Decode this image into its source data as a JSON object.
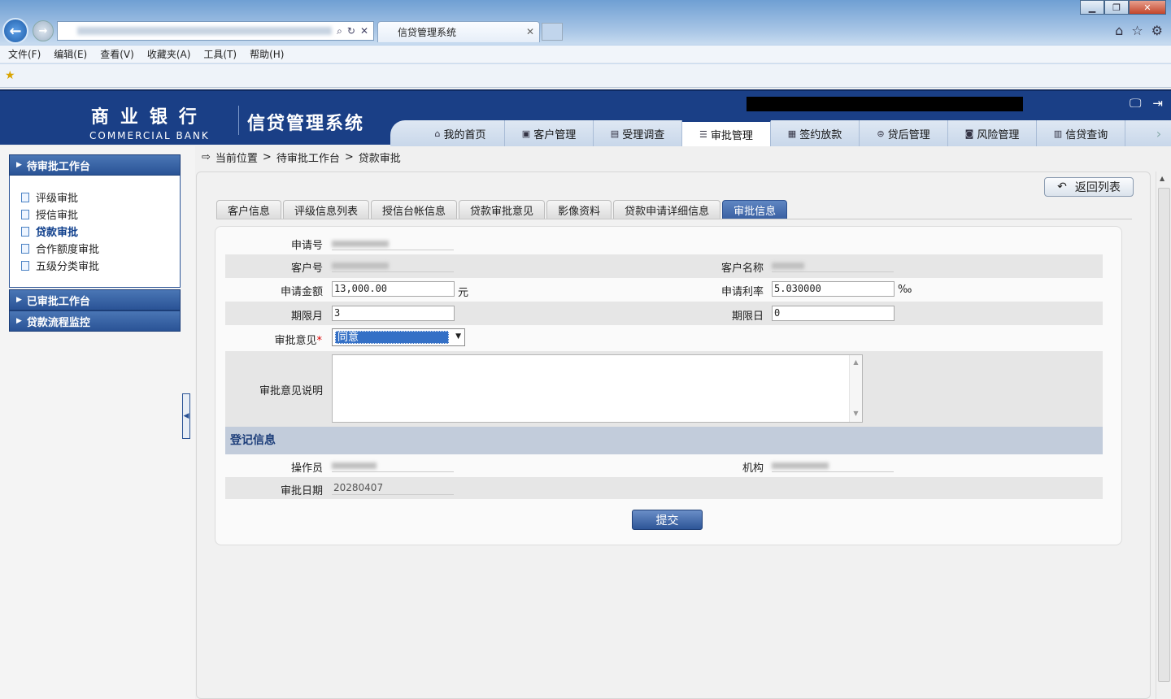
{
  "browser": {
    "tab_title": "信贷管理系统",
    "menu": [
      "文件(F)",
      "编辑(E)",
      "查看(V)",
      "收藏夹(A)",
      "工具(T)",
      "帮助(H)"
    ]
  },
  "header": {
    "bank_cn": "商业银行",
    "bank_en": "COMMERCIAL BANK",
    "system_name": "信贷管理系统",
    "nav": [
      {
        "label": "我的首页",
        "icon": "home-icon"
      },
      {
        "label": "客户管理",
        "icon": "customer-icon"
      },
      {
        "label": "受理调查",
        "icon": "survey-icon"
      },
      {
        "label": "审批管理",
        "icon": "approval-icon",
        "active": true
      },
      {
        "label": "签约放款",
        "icon": "contract-icon"
      },
      {
        "label": "贷后管理",
        "icon": "postloan-icon"
      },
      {
        "label": "风险管理",
        "icon": "risk-icon"
      },
      {
        "label": "信贷查询",
        "icon": "query-icon"
      }
    ]
  },
  "sidebar": {
    "pending_title": "待审批工作台",
    "items": [
      "评级审批",
      "授信审批",
      "贷款审批",
      "合作额度审批",
      "五级分类审批"
    ],
    "selected_index": 2,
    "approved_title": "已审批工作台",
    "monitor_title": "贷款流程监控"
  },
  "breadcrumb": {
    "current": "当前位置",
    "sep": ">",
    "level1": "待审批工作台",
    "level2": "贷款审批"
  },
  "return_label": "返回列表",
  "tabs": [
    "客户信息",
    "评级信息列表",
    "授信台帐信息",
    "贷款审批意见",
    "影像资料",
    "贷款申请详细信息",
    "审批信息"
  ],
  "active_tab": 6,
  "form": {
    "apply_no_label": "申请号",
    "customer_no_label": "客户号",
    "customer_name_label": "客户名称",
    "amount_label": "申请金额",
    "amount_value": "13,000.00",
    "amount_unit": "元",
    "rate_label": "申请利率",
    "rate_value": "5.030000",
    "rate_unit": "‰",
    "term_month_label": "期限月",
    "term_month_value": "3",
    "term_day_label": "期限日",
    "term_day_value": "0",
    "opinion_label": "审批意见",
    "required_mark": "*",
    "opinion_value": "同意",
    "opinion_desc_label": "审批意见说明",
    "opinion_desc_value": ""
  },
  "register": {
    "title": "登记信息",
    "operator_label": "操作员",
    "org_label": "机构",
    "date_label": "审批日期",
    "date_value": "20280407"
  },
  "submit_label": "提交"
}
